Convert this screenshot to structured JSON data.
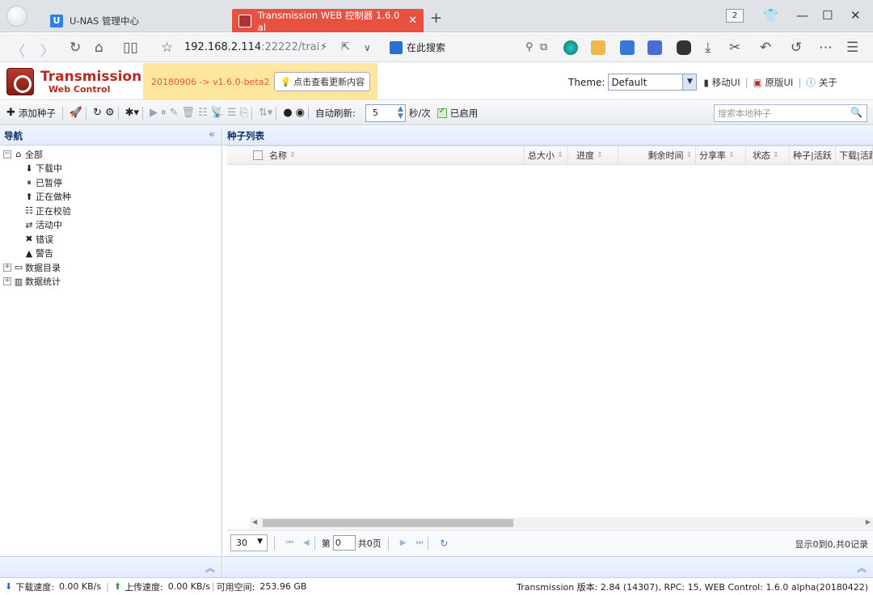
{
  "browser": {
    "tabs": [
      {
        "label": "U-NAS 管理中心",
        "favicon": "U"
      },
      {
        "label": "Transmission WEB 控制器 1.6.0 al",
        "active": true
      }
    ],
    "tab_count": "2",
    "url_host": "192.168.2.114",
    "url_rest": ":22222/trai",
    "search_placeholder": "在此搜索"
  },
  "app": {
    "brand_title": "Transmission",
    "brand_subtitle": "Web Control",
    "version_text": "20180906 -> v1.6.0-beta2",
    "update_button": "点击查看更新内容",
    "theme_label": "Theme:",
    "theme_value": "Default",
    "links": [
      "移动UI",
      "原版UI",
      "关于"
    ]
  },
  "toolbar": {
    "add_torrent": "添加种子",
    "auto_refresh_label": "自动刷新:",
    "refresh_interval": "5",
    "refresh_unit": "秒/次",
    "enabled_label": "已启用",
    "enabled": true,
    "search_placeholder": "搜索本地种子"
  },
  "nav": {
    "title": "导航",
    "root": "全部",
    "children": [
      "下载中",
      "已暂停",
      "正在做种",
      "正在校验",
      "活动中",
      "错误",
      "警告"
    ],
    "groups": [
      "数据目录",
      "数据统计"
    ]
  },
  "torrents": {
    "title": "种子列表",
    "columns": [
      "名称",
      "总大小",
      "进度",
      "剩余时间",
      "分享率",
      "状态",
      "种子|活跃",
      "下载|活跃"
    ],
    "rows": [],
    "page_size": "30",
    "page_prefix": "第",
    "page_value": "0",
    "page_total": "共0页",
    "summary": "显示0到0,共0记录"
  },
  "status": {
    "download_label": "下载速度:",
    "download_value": "0.00 KB/s",
    "upload_label": "上传速度:",
    "upload_value": "0.00 KB/s",
    "free_label": "可用空间:",
    "free_value": "253.96 GB",
    "version_info": "Transmission 版本: 2.84 (14307), RPC: 15, WEB Control: 1.6.0 alpha(20180422)"
  },
  "colors": {
    "active_tab": "#e8513f",
    "brand_red": "#b22b1f",
    "version_banner": "#fde7a0",
    "panel_header": "#e0ecff"
  }
}
